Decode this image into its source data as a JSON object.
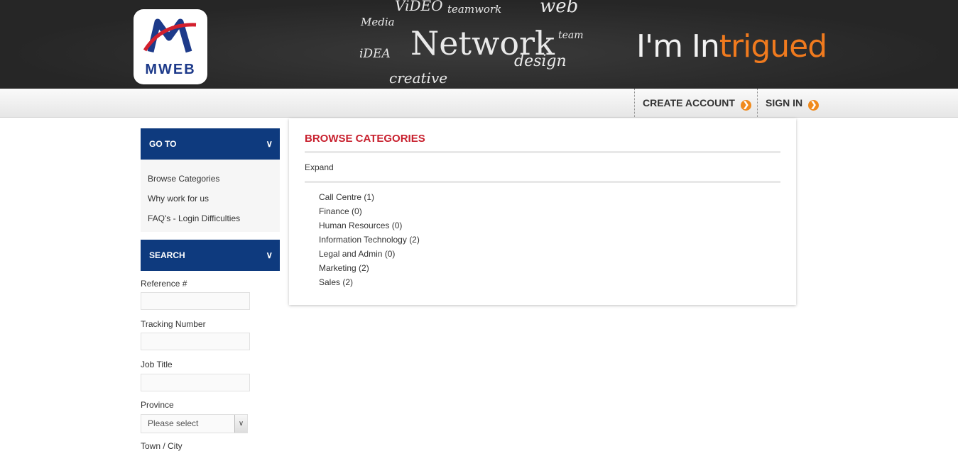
{
  "header": {
    "logo_text": "MWEB",
    "chalk_words": [
      "ViDEO",
      "teamwork",
      "web",
      "Media",
      "Network",
      "team",
      "iDEA",
      "design",
      "creative"
    ],
    "tagline_prefix": "I'm In",
    "tagline_accent": "trigued",
    "accent_color": "#f07a1e"
  },
  "nav": {
    "create_account": "CREATE ACCOUNT",
    "sign_in": "SIGN IN"
  },
  "sidebar": {
    "goto": {
      "title": "GO TO",
      "items": [
        "Browse Categories",
        "Why work for us",
        "FAQ's - Login Difficulties"
      ]
    },
    "search": {
      "title": "SEARCH",
      "fields": {
        "reference": "Reference #",
        "tracking": "Tracking Number",
        "job_title": "Job Title",
        "province": "Province",
        "town": "Town / City"
      },
      "province_selected": "Please select"
    },
    "brand_color": "#0e3a7e"
  },
  "main": {
    "title": "BROWSE CATEGORIES",
    "expand_label": "Expand",
    "categories": [
      "Call Centre (1)",
      "Finance (0)",
      "Human Resources (0)",
      "Information Technology (2)",
      "Legal and Admin (0)",
      "Marketing (2)",
      "Sales (2)"
    ],
    "title_color": "#c8202e"
  }
}
